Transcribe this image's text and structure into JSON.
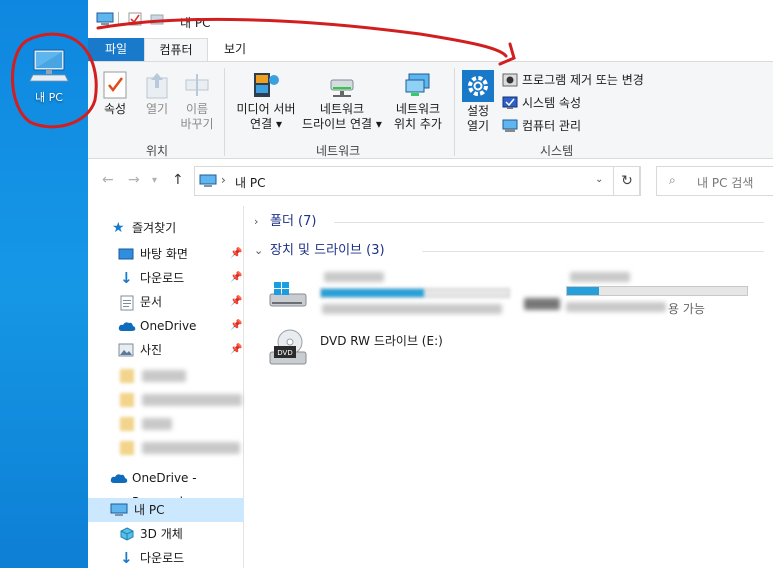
{
  "window": {
    "title": "내 PC",
    "tabs": [
      {
        "label": "파일"
      },
      {
        "label": "컴퓨터"
      },
      {
        "label": "보기"
      }
    ]
  },
  "desktop": {
    "icon_label": "내 PC"
  },
  "ribbon": {
    "location": {
      "group_label": "위치",
      "properties": "속성",
      "open": "열기",
      "rename_line1": "이름",
      "rename_line2": "바꾸기"
    },
    "network": {
      "group_label": "네트워크",
      "media_server_line1": "미디어 서버",
      "media_server_line2": "연결",
      "map_drive_line1": "네트워크",
      "map_drive_line2": "드라이브 연결",
      "add_location_line1": "네트워크",
      "add_location_line2": "위치 추가"
    },
    "system": {
      "group_label": "시스템",
      "settings_line1": "설정",
      "settings_line2": "열기",
      "uninstall": "프로그램 제거 또는 변경",
      "sys_props": "시스템 속성",
      "manage": "컴퓨터 관리"
    }
  },
  "address": {
    "path": "내 PC",
    "search_placeholder": "내 PC 검색"
  },
  "navpane": {
    "quick_access": "즐겨찾기",
    "items": [
      {
        "label": "바탕 화면"
      },
      {
        "label": "다운로드"
      },
      {
        "label": "문서"
      },
      {
        "label": "OneDrive"
      },
      {
        "label": "사진"
      }
    ],
    "onedrive_personal": "OneDrive - Personal",
    "this_pc": "내 PC",
    "sub_items": [
      {
        "label": "3D 개체"
      },
      {
        "label": "다운로드"
      }
    ]
  },
  "content": {
    "folders_header": "폴더 (7)",
    "devices_header": "장치 및 드라이브 (3)",
    "drive_d_fragment": "용 가능",
    "drive_e": "DVD RW 드라이브 (E:)",
    "drive_c_fill": 0.55,
    "drive_d_fill": 0.18
  },
  "colors": {
    "file_tab": "#1979ca",
    "selection": "#cce8ff",
    "section_text": "#1e3287",
    "annotation": "#d21e1e"
  }
}
